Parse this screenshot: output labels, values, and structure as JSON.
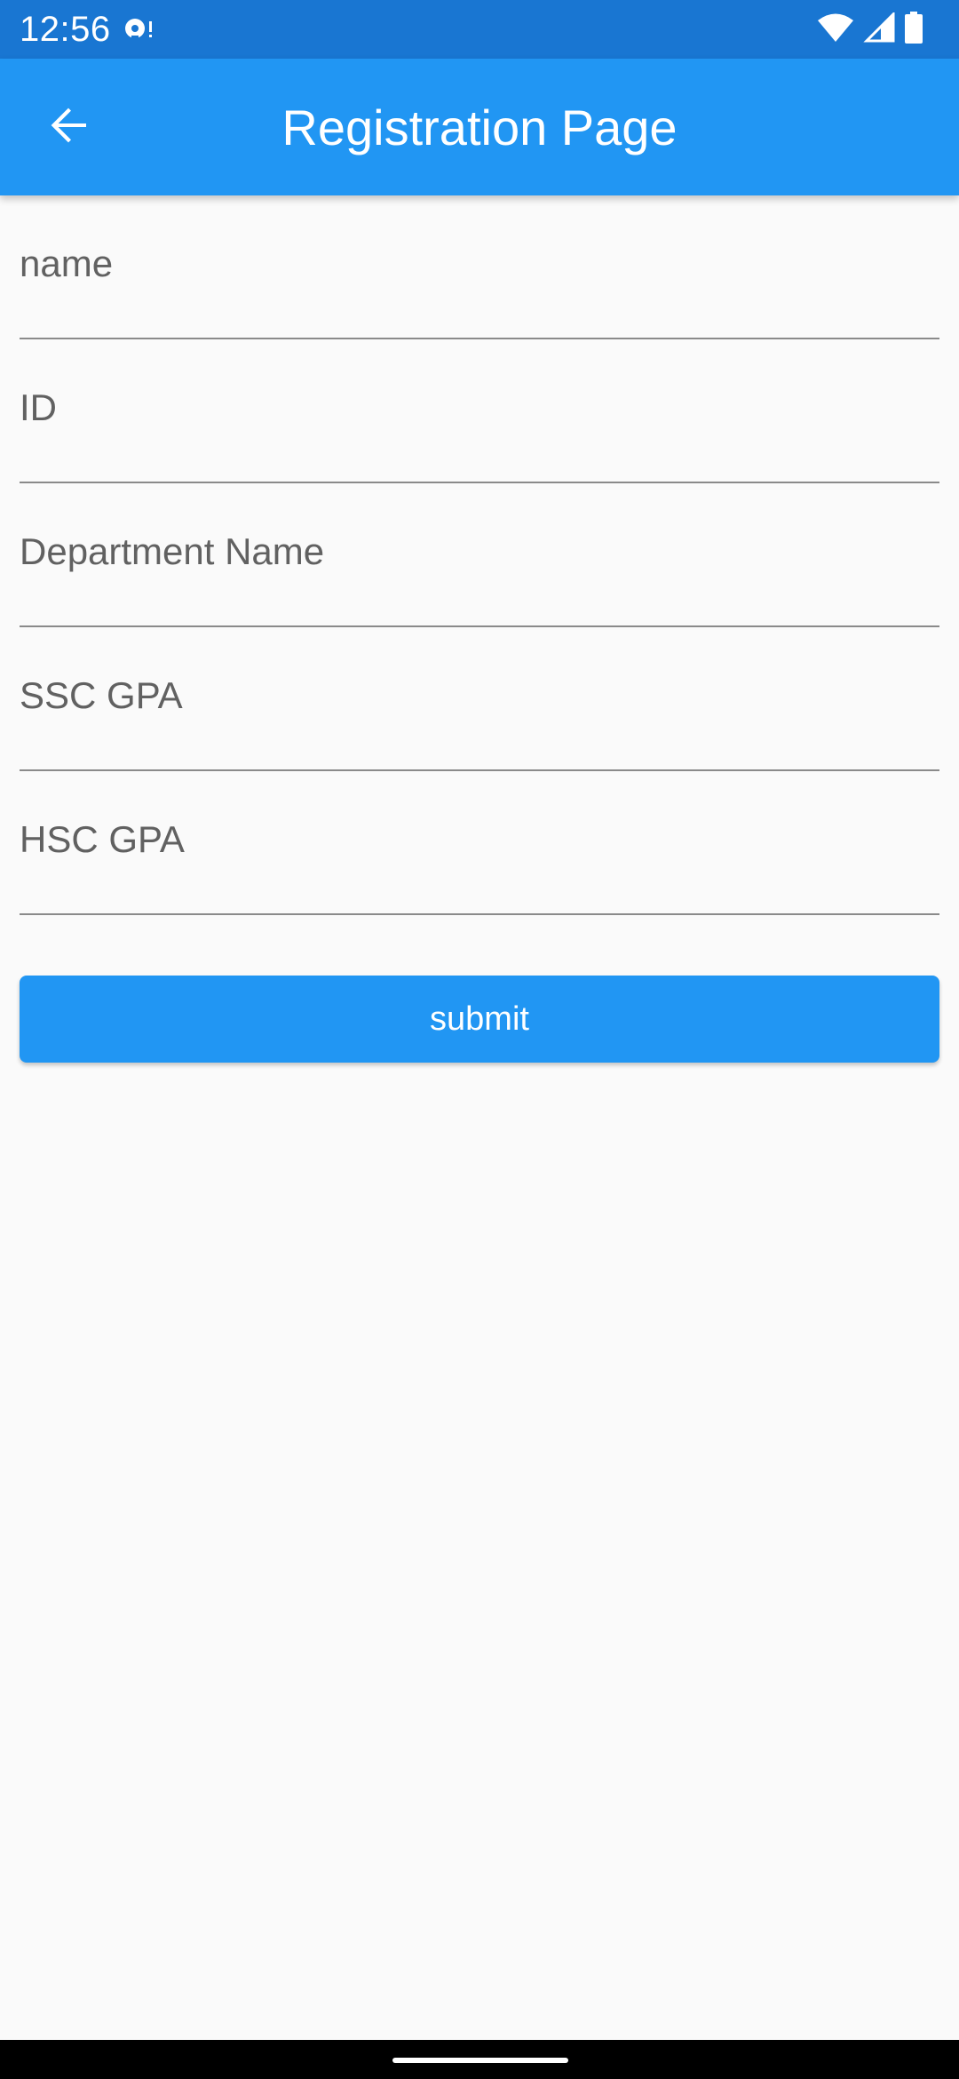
{
  "status_bar": {
    "time": "12:56",
    "icons": [
      "notification-icon",
      "wifi-icon",
      "cell-signal-icon",
      "battery-icon"
    ]
  },
  "app_bar": {
    "back_icon": "arrow-back-icon",
    "title": "Registration Page"
  },
  "form": {
    "fields": [
      {
        "placeholder": "name",
        "value": ""
      },
      {
        "placeholder": "ID",
        "value": ""
      },
      {
        "placeholder": "Department Name",
        "value": ""
      },
      {
        "placeholder": "SSC GPA",
        "value": ""
      },
      {
        "placeholder": "HSC GPA",
        "value": ""
      }
    ],
    "submit_label": "submit"
  },
  "colors": {
    "status_bar": "#1976D2",
    "primary": "#2196F3",
    "background": "#FAFAFA",
    "underline": "#8A8A8A",
    "placeholder": "#616161"
  }
}
